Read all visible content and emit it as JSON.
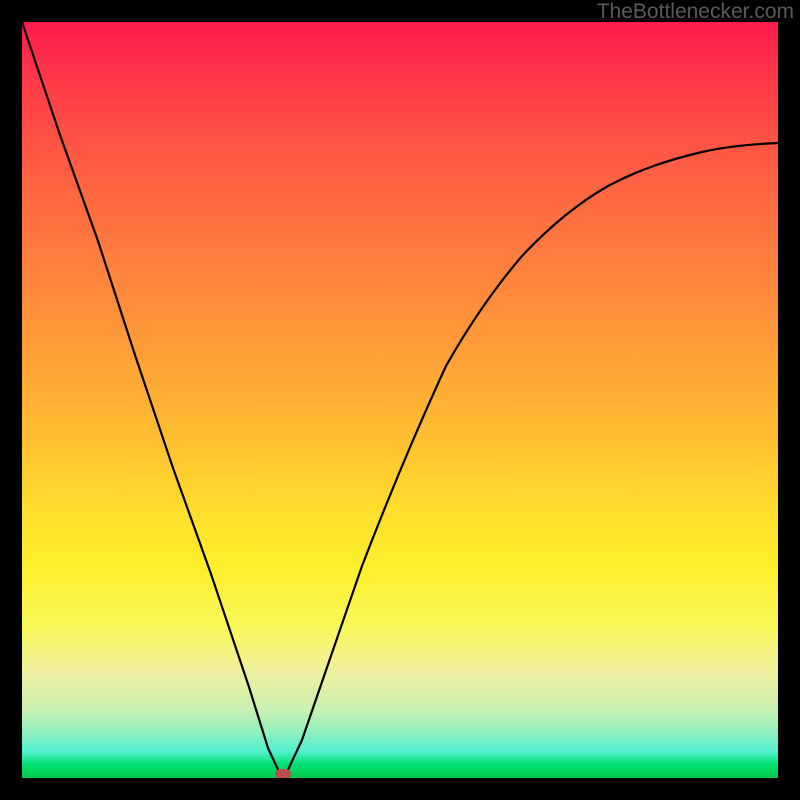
{
  "watermark": {
    "text": "TheBottlenecker.com"
  },
  "chart_data": {
    "type": "line",
    "title": "",
    "xlabel": "",
    "ylabel": "",
    "xlim": [
      0,
      100
    ],
    "ylim": [
      0,
      100
    ],
    "minimum_point": {
      "x": 34.5,
      "y": 0
    },
    "gradient_stops": [
      {
        "pos": 0,
        "color": "#ff1a4d"
      },
      {
        "pos": 0.5,
        "color": "#ffbb32"
      },
      {
        "pos": 0.8,
        "color": "#f8f85a"
      },
      {
        "pos": 1.0,
        "color": "#00c84a"
      }
    ],
    "series": [
      {
        "name": "bottleneck-curve",
        "x": [
          0,
          5,
          10,
          15,
          20,
          25,
          30,
          32.5,
          34.5,
          37,
          40,
          45,
          50,
          55,
          60,
          65,
          70,
          75,
          80,
          85,
          90,
          95,
          100
        ],
        "values": [
          100,
          85,
          71,
          56,
          41,
          27,
          12,
          4,
          0,
          5,
          14,
          28,
          40,
          50,
          58,
          65,
          70,
          74,
          77,
          79.5,
          81.5,
          83,
          84
        ]
      }
    ],
    "marker": {
      "x": 34.5,
      "y": 0,
      "color": "#b94c4c"
    }
  }
}
